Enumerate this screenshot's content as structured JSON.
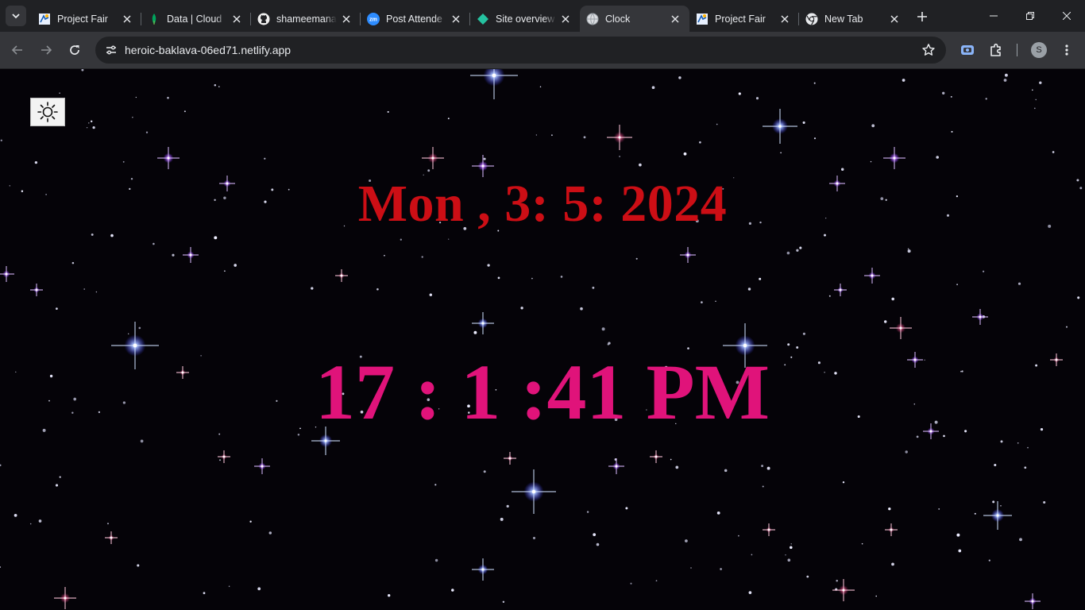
{
  "browser": {
    "tabs": [
      {
        "title": "Project Fair",
        "icon": "project-fair-favicon"
      },
      {
        "title": "Data | Cloud",
        "icon": "mongodb-leaf-icon"
      },
      {
        "title": "shameemana",
        "icon": "github-icon"
      },
      {
        "title": "Post Attende",
        "icon": "zoom-icon"
      },
      {
        "title": "Site overview",
        "icon": "netlify-icon"
      },
      {
        "title": "Clock",
        "icon": "globe-icon",
        "active": true
      },
      {
        "title": "Project Fair",
        "icon": "project-fair-favicon"
      },
      {
        "title": "New Tab",
        "icon": "chrome-icon"
      }
    ],
    "url": "heroic-baklava-06ed71.netlify.app",
    "profile_initial": "S"
  },
  "page": {
    "date": "Mon , 3: 5: 2024",
    "time": "17 : 1 :41 PM",
    "colors": {
      "date": "#cc0e15",
      "time": "#e0137a",
      "background": "#050308"
    }
  }
}
